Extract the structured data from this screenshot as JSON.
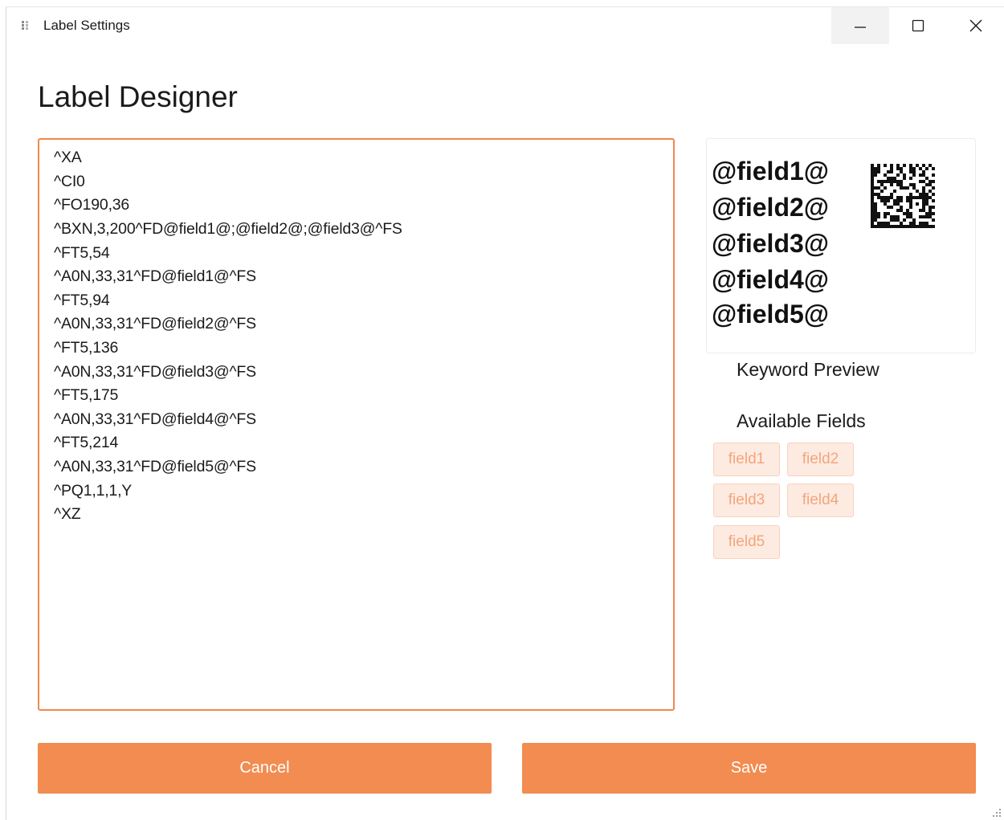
{
  "window": {
    "title": "Label Settings",
    "minimize_icon": "minimize-icon",
    "maximize_icon": "maximize-icon",
    "close_icon": "close-icon"
  },
  "page": {
    "heading": "Label Designer"
  },
  "editor": {
    "lines": [
      "^XA",
      "^CI0",
      "^FO190,36",
      "^BXN,3,200^FD@field1@;@field2@;@field3@^FS",
      "^FT5,54",
      "^A0N,33,31^FD@field1@^FS",
      "^FT5,94",
      "^A0N,33,31^FD@field2@^FS",
      "^FT5,136",
      "^A0N,33,31^FD@field3@^FS",
      "^FT5,175",
      "^A0N,33,31^FD@field4@^FS",
      "^FT5,214",
      "^A0N,33,31^FD@field5@^FS",
      "^PQ1,1,1,Y",
      "^XZ"
    ]
  },
  "preview": {
    "lines": [
      "@field1@",
      "@field2@",
      "@field3@",
      "@field4@",
      "@field5@"
    ],
    "label": "Keyword Preview",
    "barcode_icon": "datamatrix-barcode"
  },
  "fields": {
    "label": "Available Fields",
    "items": [
      "field1",
      "field2",
      "field3",
      "field4",
      "field5"
    ]
  },
  "actions": {
    "cancel": "Cancel",
    "save": "Save"
  },
  "colors": {
    "accent": "#f28c50",
    "chip_bg": "#fdebe1",
    "chip_text": "#f3a57d"
  }
}
